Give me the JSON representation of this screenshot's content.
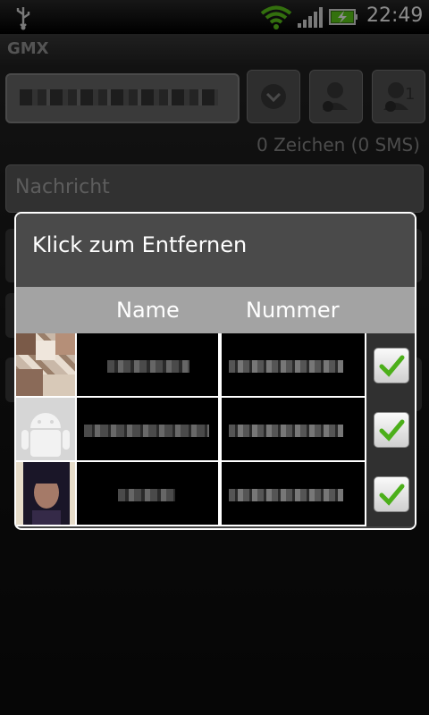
{
  "status_bar": {
    "time": "22:49"
  },
  "app": {
    "title": "GMX"
  },
  "compose": {
    "recipient_value": "",
    "counter": "0 Zeichen (0 SMS)",
    "message_placeholder": "Nachricht",
    "groups_badge": "1"
  },
  "dialog": {
    "title": "Klick zum Entfernen",
    "columns": {
      "name": "Name",
      "number": "Nummer"
    },
    "rows": [
      {
        "checked": true
      },
      {
        "checked": true
      },
      {
        "checked": true
      }
    ]
  },
  "colors": {
    "accent_green": "#4caf1a",
    "dialog_bg": "#444444",
    "header_gray": "#a3a3a3"
  }
}
